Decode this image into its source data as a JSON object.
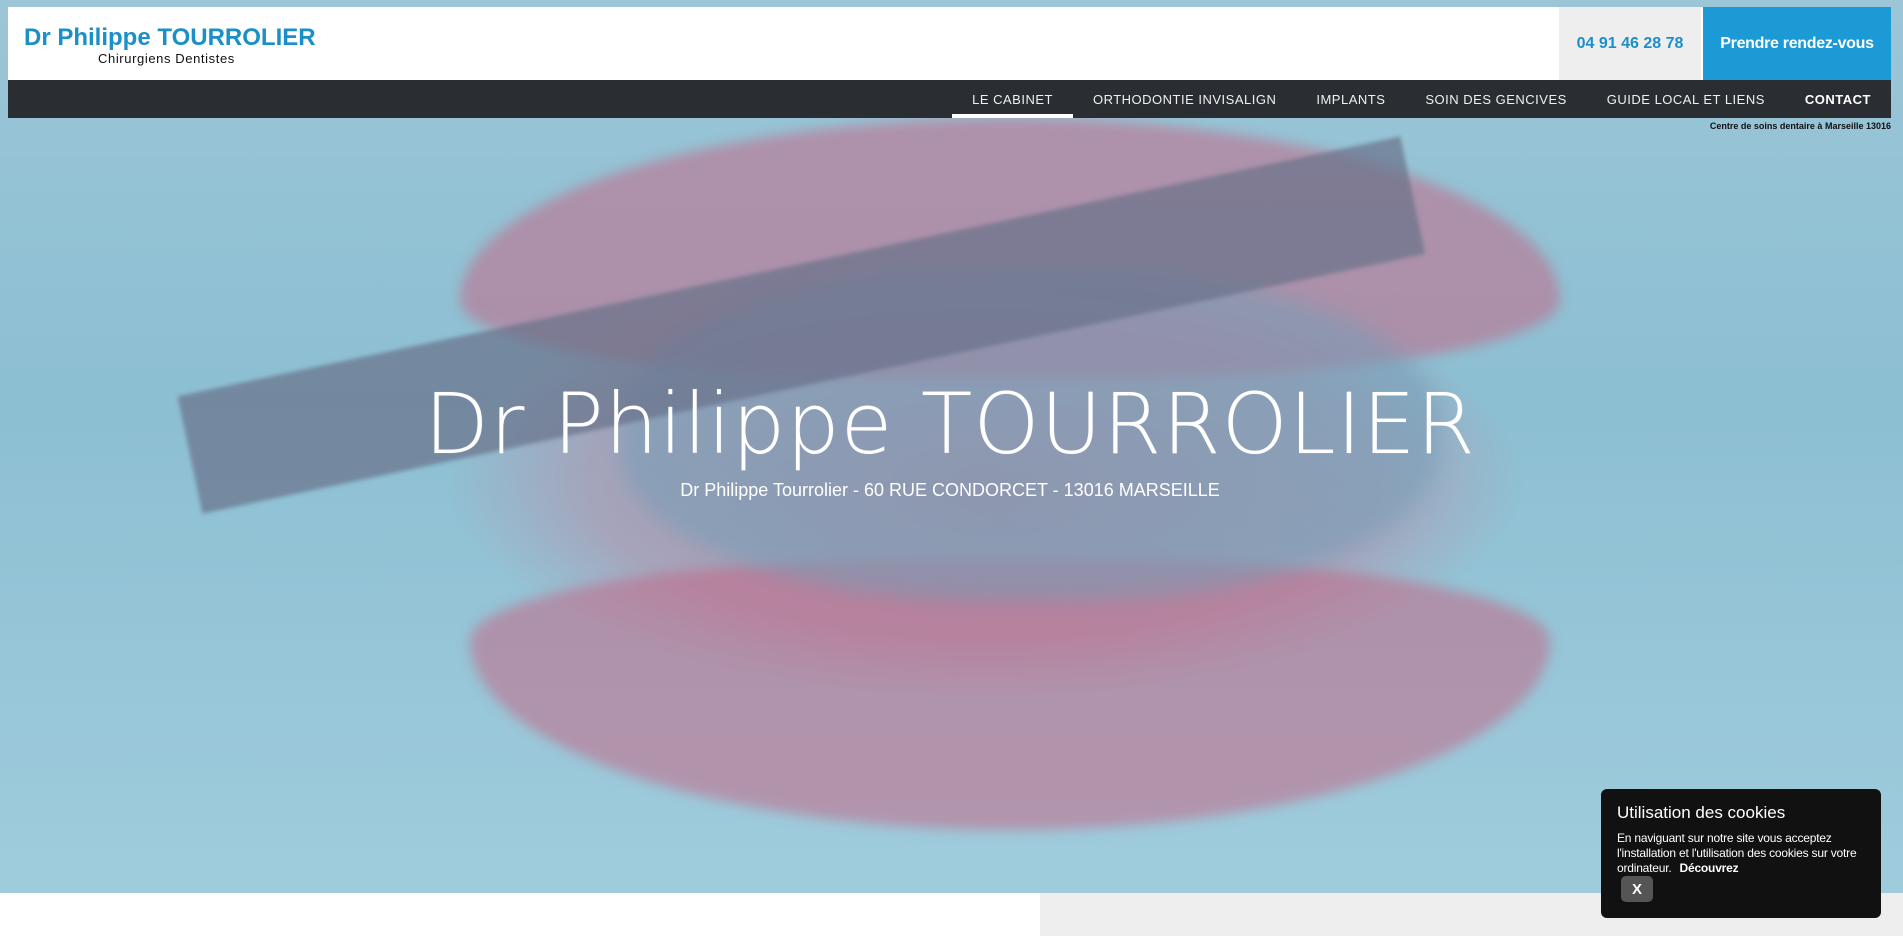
{
  "header": {
    "brand_name": "Dr Philippe TOURROLIER",
    "brand_tagline": "Chirurgiens Dentistes",
    "phone": "04 91 46 28 78",
    "rdv_label": "Prendre rendez-vous"
  },
  "nav": {
    "items": [
      {
        "label": "LE CABINET",
        "active": true
      },
      {
        "label": "ORTHODONTIE INVISALIGN"
      },
      {
        "label": "IMPLANTS"
      },
      {
        "label": "SOIN DES GENCIVES"
      },
      {
        "label": "GUIDE LOCAL ET LIENS"
      },
      {
        "label": "CONTACT",
        "bold": true
      }
    ]
  },
  "subtitle_right": "Centre de soins dentaire à Marseille 13016",
  "hero": {
    "title": "Dr Philippe TOURROLIER",
    "address": "Dr Philippe Tourrolier - 60 RUE CONDORCET - 13016 MARSEILLE"
  },
  "cookie": {
    "title": "Utilisation des cookies",
    "text": "En naviguant sur notre site vous acceptez l'installation et l'utilisation des cookies sur votre ordinateur.",
    "link": "Découvrez",
    "close": "X"
  },
  "colors": {
    "brand": "#1b8fc7",
    "button": "#1c9ad6",
    "nav_bg": "#2a2e33"
  }
}
